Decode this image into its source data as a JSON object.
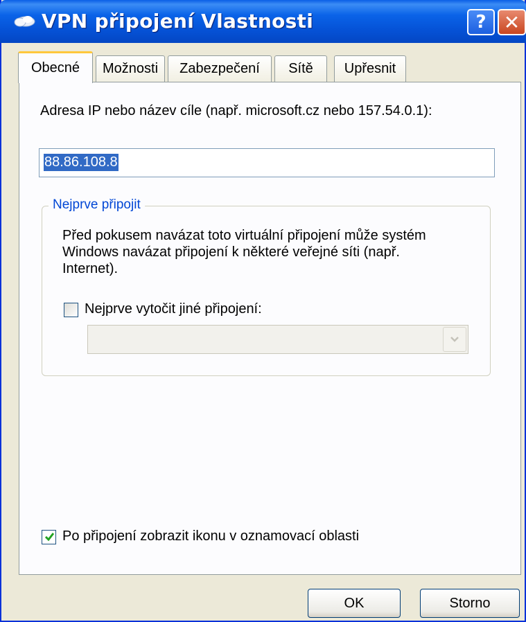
{
  "window": {
    "title": "VPN připojení Vlastnosti",
    "help_label": "?",
    "close_label": "✕"
  },
  "tabs": [
    {
      "label": "Obecné",
      "active": true
    },
    {
      "label": "Možnosti",
      "active": false
    },
    {
      "label": "Zabezpečení",
      "active": false
    },
    {
      "label": "Sítě",
      "active": false
    },
    {
      "label": "Upřesnit",
      "active": false
    }
  ],
  "general": {
    "address_label": "Adresa IP nebo název cíle (např. microsoft.cz nebo 157.54.0.1):",
    "address_value": "88.86.108.8",
    "first_connect": {
      "title": "Nejprve připojit",
      "description_lines": [
        "Před pokusem navázat toto virtuální připojení může systém",
        "Windows navázat připojení k některé veřejné síti (např.",
        "Internet)."
      ],
      "dial_checkbox_label": "Nejprve vytočit jiné připojení:",
      "dial_checked": false,
      "dial_select_value": ""
    },
    "show_icon_label": "Po připojení zobrazit ikonu v oznamovací oblasti",
    "show_icon_checked": true
  },
  "buttons": {
    "ok": "OK",
    "cancel": "Storno"
  },
  "colors": {
    "titlebar": "#0a5fe6",
    "dialog_bg": "#ece9d8",
    "group_title": "#0046d5",
    "selection": "#316ac5",
    "active_tab_accent": "#ffc83c"
  }
}
